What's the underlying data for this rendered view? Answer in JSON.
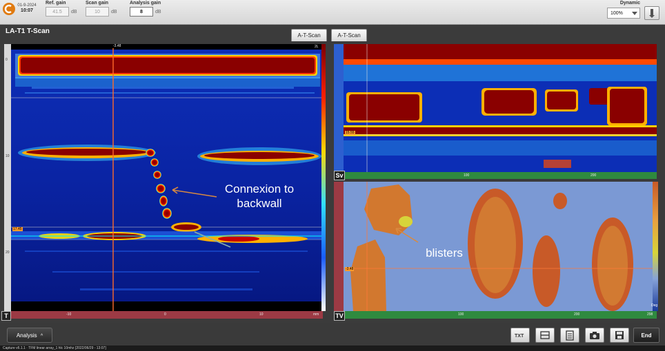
{
  "toolbar": {
    "date": "01-9-2024",
    "time": "10:07",
    "ref_gain": {
      "label": "Ref. gain",
      "value": "41.5",
      "unit": "dB"
    },
    "scan_gain": {
      "label": "Scan gain",
      "value": "10",
      "unit": "dB"
    },
    "analysis_gain": {
      "label": "Analysis gain",
      "value": "8",
      "unit": "dB"
    },
    "dynamic": {
      "label": "Dynamic",
      "value": "100%"
    }
  },
  "view": {
    "title": "LA-T1 T-Scan",
    "tabs": [
      "A-T-Scan",
      "A-T-Scan"
    ]
  },
  "tscan": {
    "badge": "T",
    "cursor_label": "-3.48",
    "corner_label": "2L",
    "depth_marker": "17.45",
    "x_ticks": [
      "-10",
      "0",
      "10"
    ],
    "x_unit": "mm",
    "y_ticks": [
      "0",
      "10",
      "20"
    ],
    "annotation_line1": "Connexion to",
    "annotation_line2": "backwall"
  },
  "sv": {
    "badge": "Sv",
    "marker": "15.55",
    "x_ticks": [
      "100",
      "200"
    ]
  },
  "tv": {
    "badge": "TV",
    "marker": "-3.48",
    "x_ticks": [
      "100",
      "200",
      "298"
    ],
    "unit": "Deg",
    "annotation": "blisters"
  },
  "bottom": {
    "analysis_label": "Analysis",
    "end_label": "End",
    "tools": [
      "txt-icon",
      "layout-icon",
      "report-icon",
      "camera-icon",
      "save-icon"
    ],
    "status": "Capture v6.1.1 · TFM linear array_1 hlc 10mhz [2022/06/29 - 13:07]"
  },
  "colors": {
    "scan_background": "#0a1f9c",
    "hot": "#7a0000",
    "top_toolbar": "#e4e4e4",
    "cursor": "#ff6a2a"
  }
}
